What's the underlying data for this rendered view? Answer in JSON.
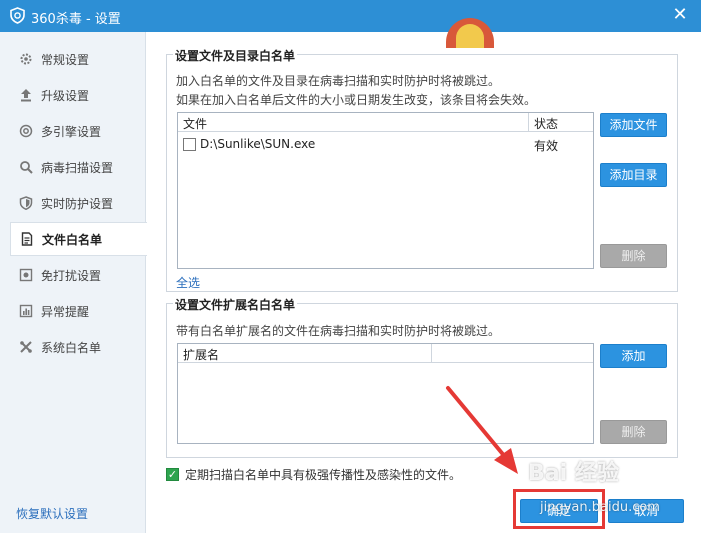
{
  "window": {
    "title": "360杀毒 - 设置",
    "close_glyph": "✕"
  },
  "sidebar": {
    "items": [
      {
        "label": "常规设置",
        "icon": "gear-icon"
      },
      {
        "label": "升级设置",
        "icon": "upload-icon"
      },
      {
        "label": "多引擎设置",
        "icon": "engine-icon"
      },
      {
        "label": "病毒扫描设置",
        "icon": "search-icon"
      },
      {
        "label": "实时防护设置",
        "icon": "shield-icon"
      },
      {
        "label": "文件白名单",
        "icon": "document-icon",
        "active": true
      },
      {
        "label": "免打扰设置",
        "icon": "do-not-disturb-icon"
      },
      {
        "label": "异常提醒",
        "icon": "chart-icon"
      },
      {
        "label": "系统白名单",
        "icon": "tools-icon"
      }
    ],
    "reset_label": "恢复默认设置"
  },
  "file_whitelist": {
    "title": "设置文件及目录白名单",
    "desc1": "加入白名单的文件及目录在病毒扫描和实时防护时将被跳过。",
    "desc2": "如果在加入白名单后文件的大小或日期发生改变，该条目将会失效。",
    "columns": [
      "文件",
      "状态"
    ],
    "rows": [
      {
        "file": "D:\\Sunlike\\SUN.exe",
        "status": "有效",
        "checked": false
      }
    ],
    "add_file_label": "添加文件",
    "add_dir_label": "添加目录",
    "delete_label": "删除",
    "select_all_label": "全选"
  },
  "ext_whitelist": {
    "title": "设置文件扩展名白名单",
    "desc": "带有白名单扩展名的文件在病毒扫描和实时防护时将被跳过。",
    "columns": [
      "扩展名"
    ],
    "add_label": "添加",
    "delete_label": "删除"
  },
  "periodic_scan": {
    "label": "定期扫描白名单中具有极强传播性及感染性的文件。",
    "checked": true
  },
  "footer": {
    "ok_label": "确定",
    "cancel_label": "取消"
  },
  "watermark": {
    "text": "Bai 经验",
    "sub": "jingyan.baidu.com"
  },
  "colors": {
    "titlebar": "#2d8fd5",
    "primary_button": "#2c93e0",
    "annotation": "#e53935"
  }
}
